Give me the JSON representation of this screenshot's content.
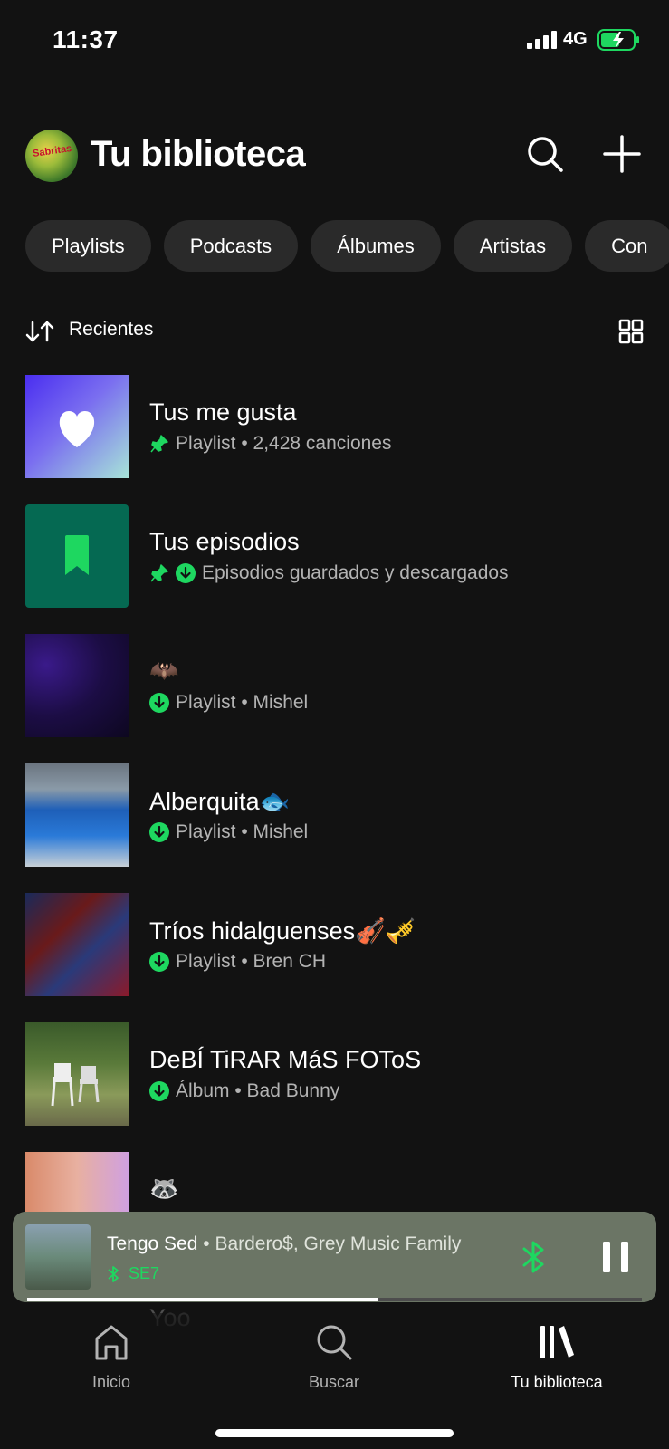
{
  "status_bar": {
    "time": "11:37",
    "network": "4G"
  },
  "header": {
    "title": "Tu biblioteca",
    "avatar_text": "Sabritas"
  },
  "filters": [
    "Playlists",
    "Podcasts",
    "Álbumes",
    "Artistas",
    "Con"
  ],
  "sort": {
    "label": "Recientes"
  },
  "items": [
    {
      "title": "Tus me gusta",
      "subtitle": "Playlist • 2,428 canciones",
      "pinned": true,
      "downloaded": false
    },
    {
      "title": "Tus episodios",
      "subtitle": "Episodios guardados y descargados",
      "pinned": true,
      "downloaded": true
    },
    {
      "title": "🦇",
      "subtitle": "Playlist • Mishel",
      "pinned": false,
      "downloaded": true
    },
    {
      "title": "Alberquita🐟",
      "subtitle": "Playlist • Mishel",
      "pinned": false,
      "downloaded": true
    },
    {
      "title": "Tríos hidalguenses🎻🎺",
      "subtitle": "Playlist • Bren CH",
      "pinned": false,
      "downloaded": true
    },
    {
      "title": "DeBÍ TiRAR MáS FOToS",
      "subtitle": "Álbum • Bad Bunny",
      "pinned": false,
      "downloaded": true
    },
    {
      "title": "🦝",
      "subtitle": "",
      "pinned": false,
      "downloaded": false
    }
  ],
  "ghost_item": {
    "title": "Yoo"
  },
  "player": {
    "track": "Tengo Sed",
    "separator": " • ",
    "artists": "Bardero$, Grey Music Family",
    "device": "SE7",
    "progress": 0.57
  },
  "nav": {
    "home": "Inicio",
    "search": "Buscar",
    "library": "Tu biblioteca"
  },
  "colors": {
    "accent": "#1ed760",
    "background": "#121212",
    "chip": "#2a2a2a",
    "player_bg": "#6b7565"
  }
}
